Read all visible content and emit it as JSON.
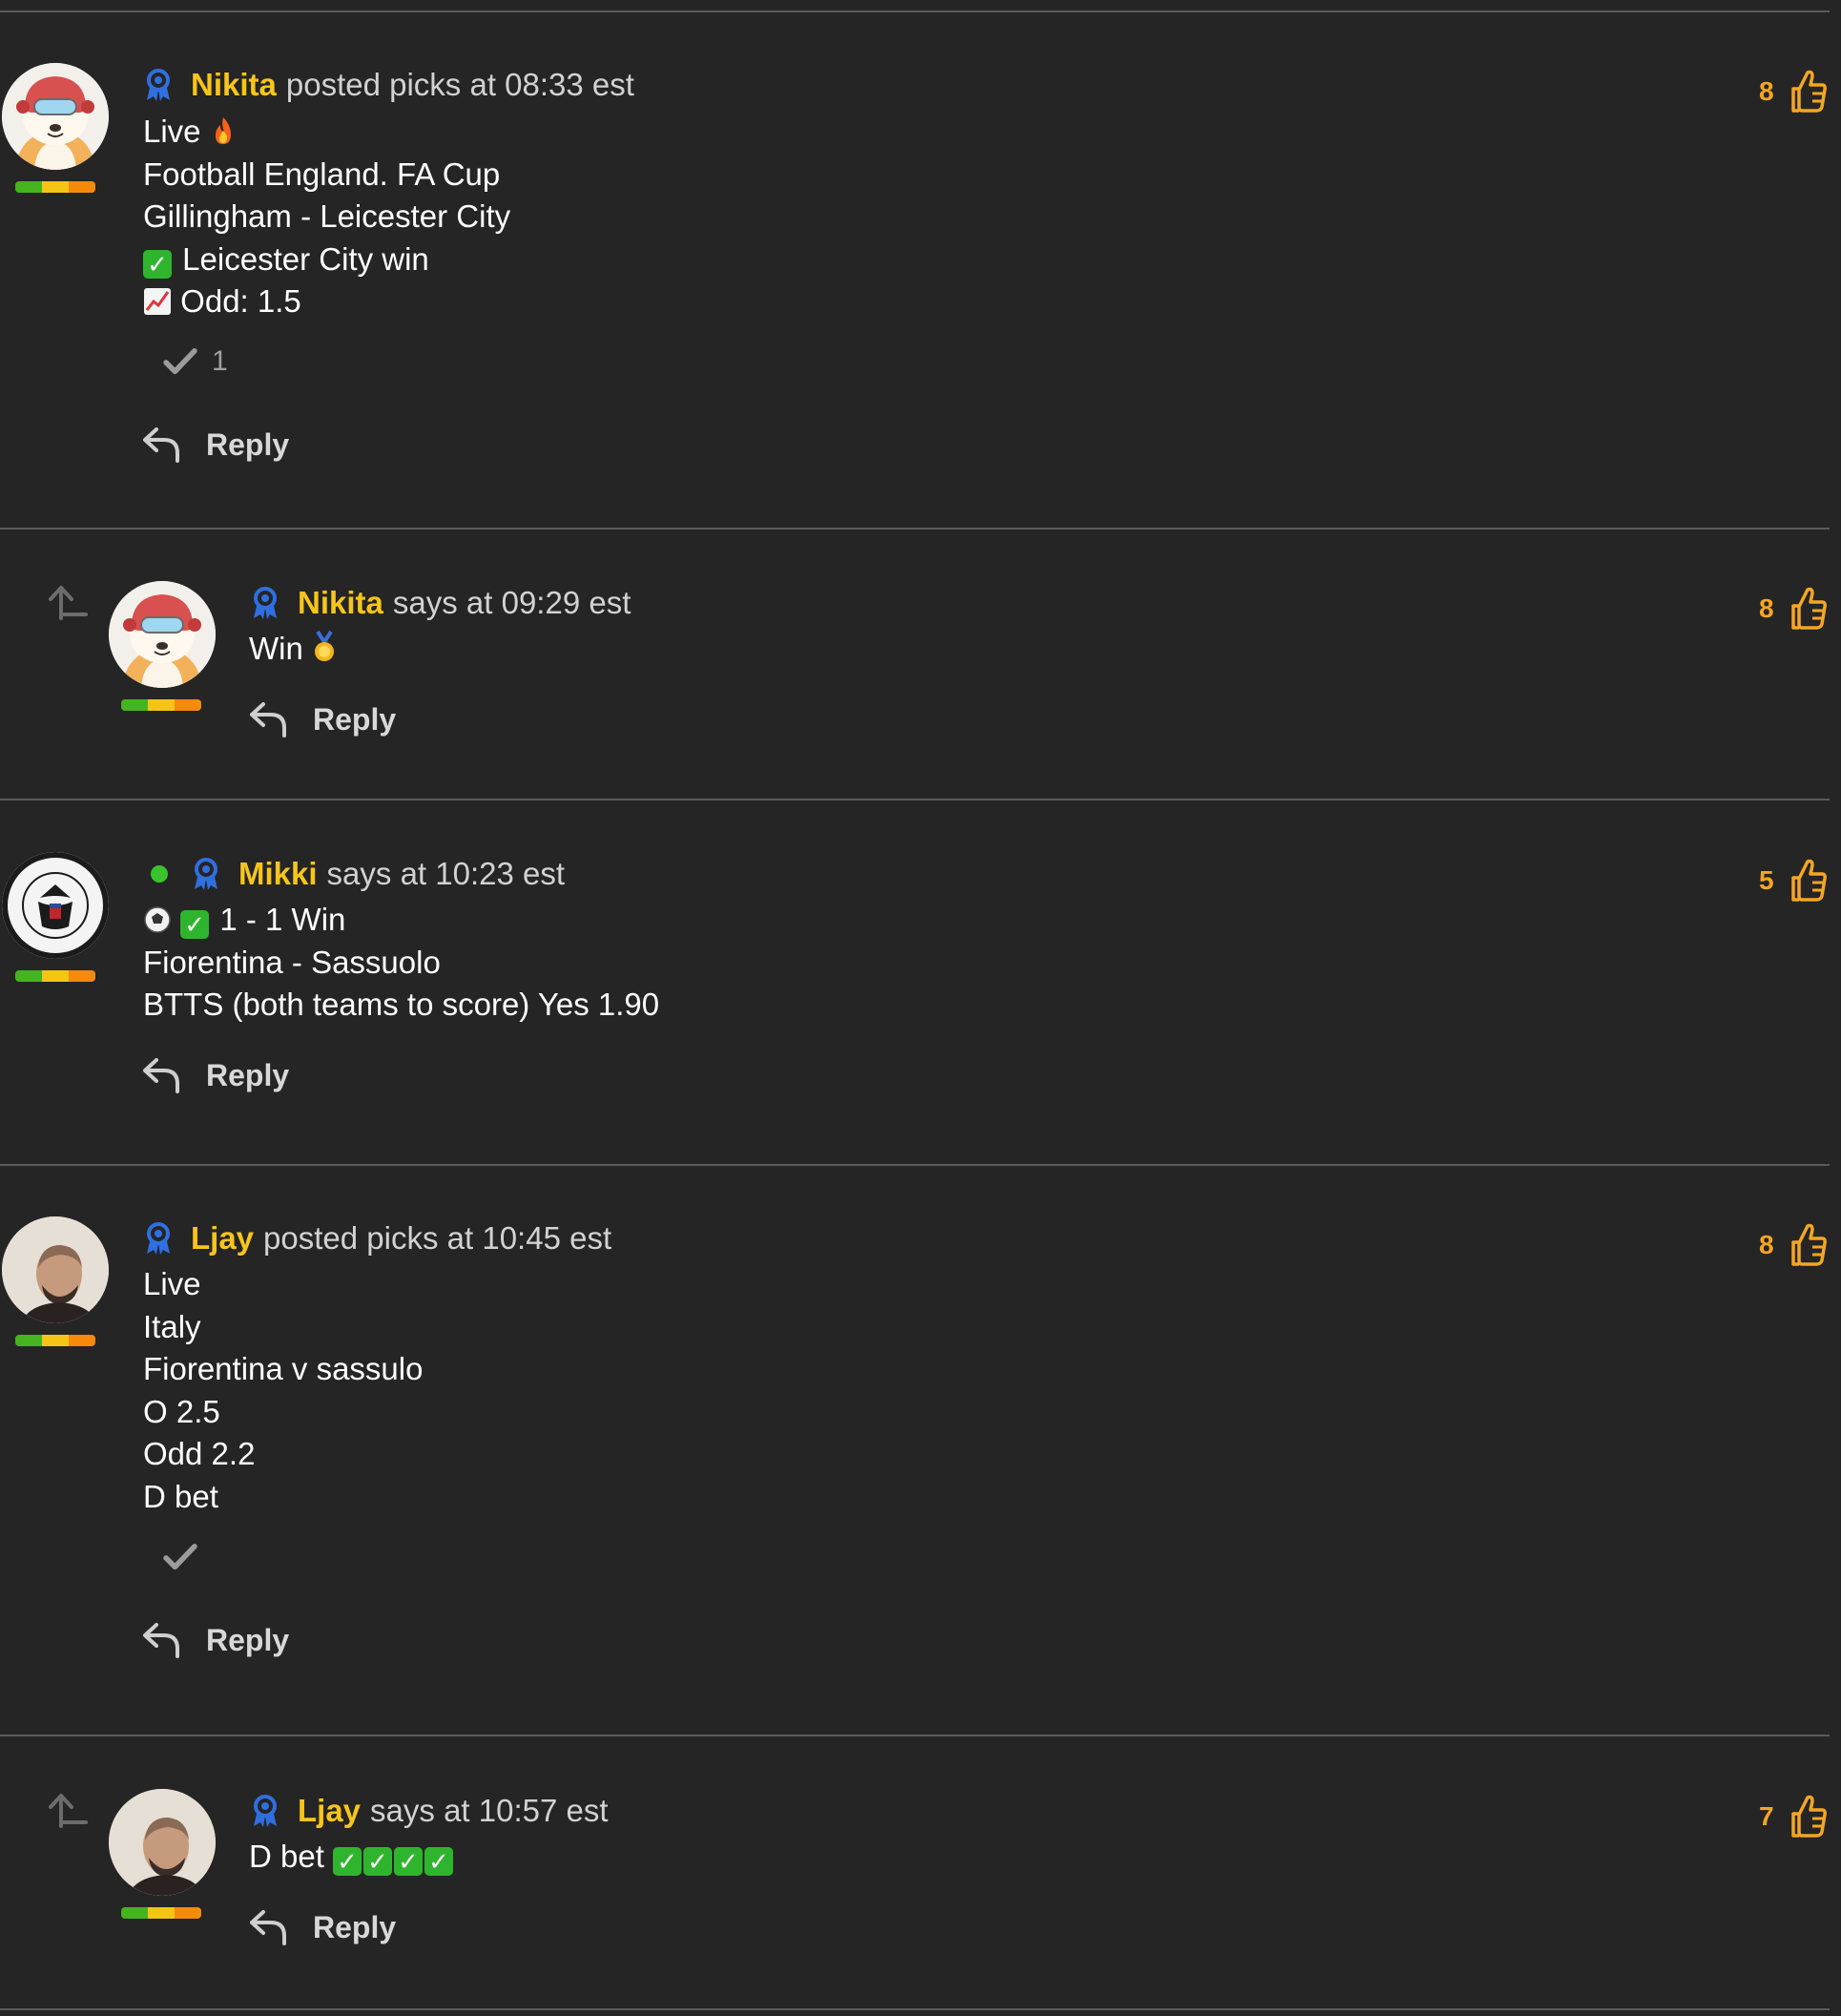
{
  "colors": {
    "background": "#252525",
    "username": "#f7c51a",
    "like": "#f5a623",
    "divider": "#5a5a5a",
    "online": "#39c42c"
  },
  "comments": [
    {
      "username": "Nikita",
      "meta": "posted picks at 08:33 est",
      "avatar": "shiba-astronaut",
      "lines": [
        "Live",
        "Football England. FA Cup",
        "Gillingham - Leicester City",
        "Leicester City win",
        "Odd: 1.5"
      ],
      "reaction_count": "1",
      "reply_label": "Reply",
      "likes": "8"
    },
    {
      "username": "Nikita",
      "meta": "says at 09:29 est",
      "avatar": "shiba-astronaut",
      "lines": [
        "Win"
      ],
      "reply_label": "Reply",
      "likes": "8"
    },
    {
      "username": "Mikki",
      "meta": "says at 10:23 est",
      "avatar": "ramones-seal",
      "avatar_seal_text": "RAMONES HEY HO LET'S GO",
      "online": true,
      "lines": [
        "1 - 1 Win",
        "Fiorentina - Sassuolo",
        "BTTS (both teams to score) Yes 1.90"
      ],
      "reply_label": "Reply",
      "likes": "5"
    },
    {
      "username": "Ljay",
      "meta": "posted picks at 10:45 est",
      "avatar": "user-photo",
      "lines": [
        "Live",
        "Italy",
        "Fiorentina v sassulo",
        "O 2.5",
        "Odd 2.2",
        "D bet"
      ],
      "reply_label": "Reply",
      "likes": "8"
    },
    {
      "username": "Ljay",
      "meta": "says at 10:57 est",
      "avatar": "user-photo",
      "lines": [
        "D bet"
      ],
      "reply_label": "Reply",
      "likes": "7"
    }
  ]
}
